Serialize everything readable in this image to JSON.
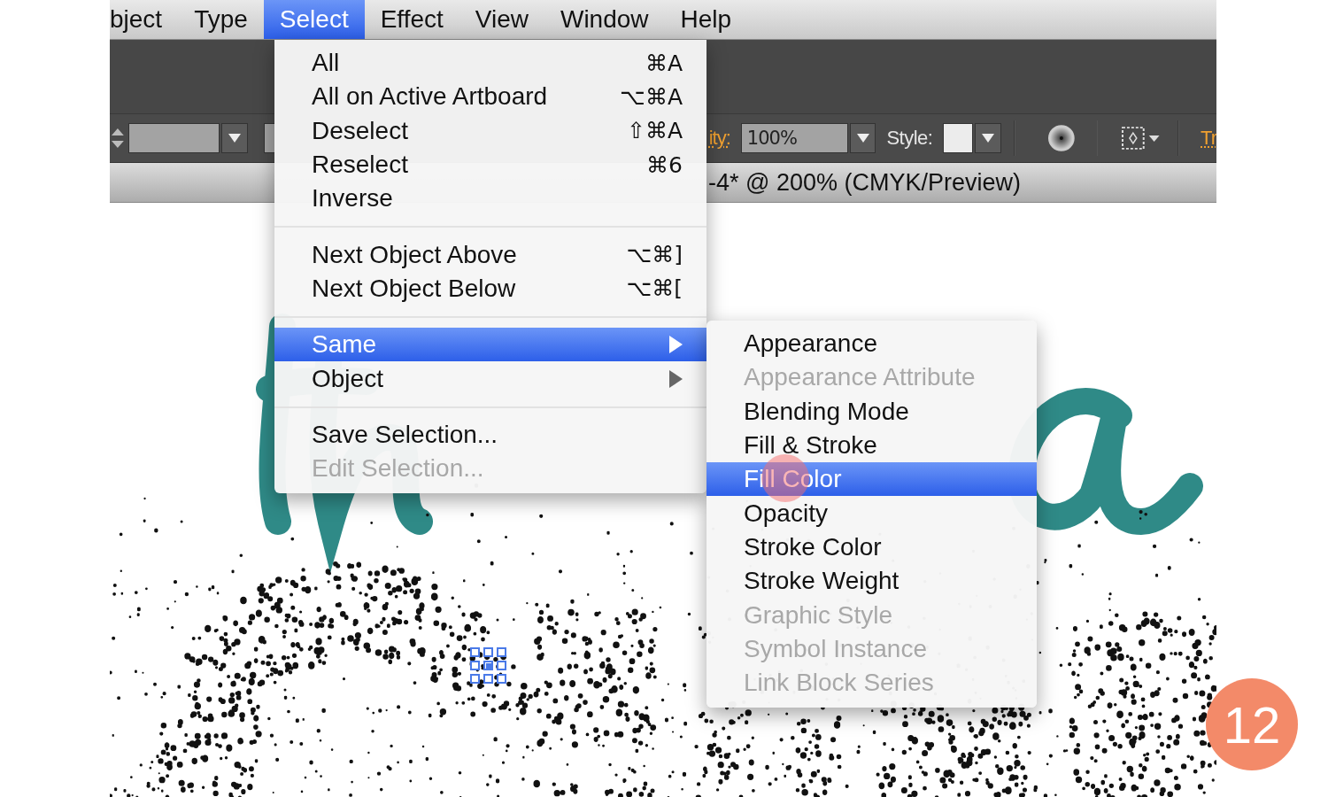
{
  "menu_bar": {
    "items": [
      {
        "label": "bject",
        "selected": false
      },
      {
        "label": "Type",
        "selected": false
      },
      {
        "label": "Select",
        "selected": true
      },
      {
        "label": "Effect",
        "selected": false
      },
      {
        "label": "View",
        "selected": false
      },
      {
        "label": "Window",
        "selected": false
      },
      {
        "label": "Help",
        "selected": false
      }
    ]
  },
  "control_bar": {
    "opacity_label": "ity:",
    "opacity_value": "100%",
    "style_label": "Style:",
    "cut_label": "Tr"
  },
  "document_tab": {
    "title": "-4* @ 200% (CMYK/Preview)"
  },
  "select_menu": {
    "sections": [
      [
        {
          "label": "All",
          "shortcut": "⌘A",
          "disabled": false,
          "selected": false,
          "submenu": false
        },
        {
          "label": "All on Active Artboard",
          "shortcut": "⌥⌘A",
          "disabled": false,
          "selected": false,
          "submenu": false
        },
        {
          "label": "Deselect",
          "shortcut": "⇧⌘A",
          "disabled": false,
          "selected": false,
          "submenu": false
        },
        {
          "label": "Reselect",
          "shortcut": "⌘6",
          "disabled": false,
          "selected": false,
          "submenu": false
        },
        {
          "label": "Inverse",
          "disabled": false,
          "selected": false,
          "submenu": false
        }
      ],
      [
        {
          "label": "Next Object Above",
          "shortcut": "⌥⌘]",
          "disabled": false,
          "selected": false,
          "submenu": false
        },
        {
          "label": "Next Object Below",
          "shortcut": "⌥⌘[",
          "disabled": false,
          "selected": false,
          "submenu": false
        }
      ],
      [
        {
          "label": "Same",
          "disabled": false,
          "selected": true,
          "submenu": true
        },
        {
          "label": "Object",
          "disabled": false,
          "selected": false,
          "submenu": true
        }
      ],
      [
        {
          "label": "Save Selection...",
          "disabled": false,
          "selected": false,
          "submenu": false
        },
        {
          "label": "Edit Selection...",
          "disabled": true,
          "selected": false,
          "submenu": false
        }
      ]
    ]
  },
  "same_submenu": {
    "items": [
      {
        "label": "Appearance",
        "disabled": false,
        "selected": false
      },
      {
        "label": "Appearance Attribute",
        "disabled": true,
        "selected": false
      },
      {
        "label": "Blending Mode",
        "disabled": false,
        "selected": false
      },
      {
        "label": "Fill & Stroke",
        "disabled": false,
        "selected": false
      },
      {
        "label": "Fill Color",
        "disabled": false,
        "selected": true
      },
      {
        "label": "Opacity",
        "disabled": false,
        "selected": false
      },
      {
        "label": "Stroke Color",
        "disabled": false,
        "selected": false
      },
      {
        "label": "Stroke Weight",
        "disabled": false,
        "selected": false
      },
      {
        "label": "Graphic Style",
        "disabled": true,
        "selected": false
      },
      {
        "label": "Symbol Instance",
        "disabled": true,
        "selected": false
      },
      {
        "label": "Link Block Series",
        "disabled": true,
        "selected": false
      }
    ]
  },
  "step_badge": "12"
}
